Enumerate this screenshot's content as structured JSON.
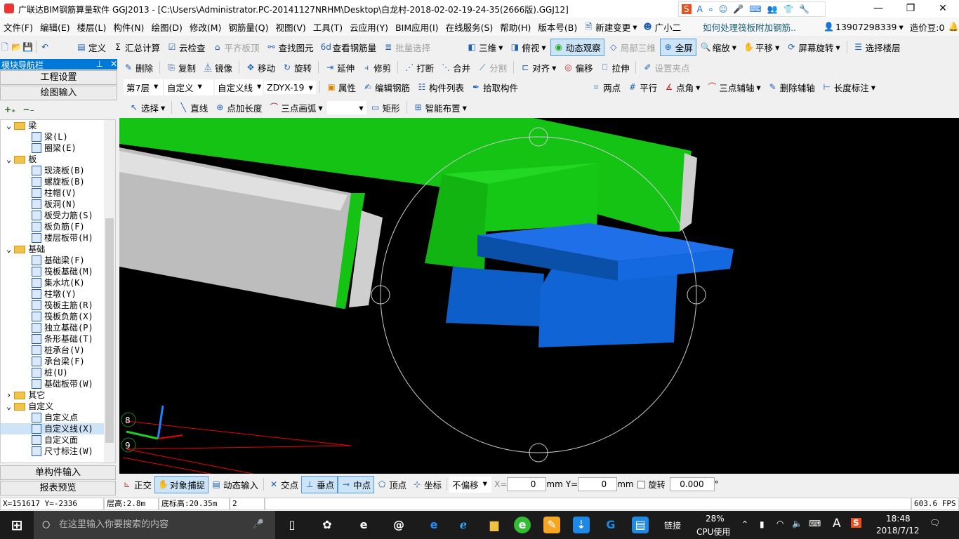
{
  "window": {
    "title": "广联达BIM钢筋算量软件 GGJ2013 - [C:\\Users\\Administrator.PC-20141127NRHM\\Desktop\\白龙村-2018-02-02-19-24-35(2666版).GGJ12]",
    "minimize": "—",
    "maximize": "❐",
    "close": "✕"
  },
  "menu": [
    "文件(F)",
    "编辑(E)",
    "楼层(L)",
    "构件(N)",
    "绘图(D)",
    "修改(M)",
    "钢筋量(Q)",
    "视图(V)",
    "工具(T)",
    "云应用(Y)",
    "BIM应用(I)",
    "在线服务(S)",
    "帮助(H)",
    "版本号(B)"
  ],
  "menu_extra": {
    "new_change": "新建变更",
    "assistant": "广小二",
    "news": "如何处理筏板附加钢筋..",
    "phone": "13907298339",
    "beans": "造价豆:0"
  },
  "toolbar1": {
    "define": "定义",
    "sum": "汇总计算",
    "cloud_check": "云检查",
    "align_top": "平齐板顶",
    "find": "查找图元",
    "view_rebar": "查看钢筋量",
    "batch_select": "批量选择",
    "view3d": "三维",
    "top_view": "俯视",
    "dynamic": "动态观察",
    "local3d": "局部三维",
    "fullscreen": "全屏",
    "zoom": "缩放",
    "pan": "平移",
    "rotate_screen": "屏幕旋转",
    "select_floor": "选择楼层"
  },
  "toolbar2": {
    "delete": "删除",
    "copy": "复制",
    "mirror": "镜像",
    "move": "移动",
    "rotate": "旋转",
    "extend": "延伸",
    "trim": "修剪",
    "break": "打断",
    "merge": "合并",
    "split": "分割",
    "align": "对齐",
    "offset": "偏移",
    "stretch": "拉伸",
    "set_grip": "设置夹点"
  },
  "toolbar3": {
    "floor": "第7层",
    "category": "自定义",
    "type": "自定义线",
    "name": "ZDYX-19",
    "props": "属性",
    "edit_rebar": "编辑钢筋",
    "list": "构件列表",
    "pick": "拾取构件",
    "two_point": "两点",
    "parallel": "平行",
    "point_angle": "点角",
    "three_point_axis": "三点辅轴",
    "del_axis": "删除辅轴",
    "length_dim": "长度标注"
  },
  "toolbar4": {
    "select": "选择",
    "line": "直线",
    "point_length": "点加长度",
    "arc": "三点画弧",
    "rect": "矩形",
    "smart": "智能布置"
  },
  "sidebar": {
    "title": "模块导航栏",
    "pin": "ꟷ",
    "close": "✕",
    "project_settings": "工程设置",
    "drawing_input": "绘图输入",
    "single_input": "单构件输入",
    "report": "报表预览",
    "tree": [
      {
        "label": "梁",
        "children": [
          "梁(L)",
          "圈梁(E)"
        ]
      },
      {
        "label": "板",
        "children": [
          "现浇板(B)",
          "螺旋板(B)",
          "柱帽(V)",
          "板洞(N)",
          "板受力筋(S)",
          "板负筋(F)",
          "楼层板带(H)"
        ]
      },
      {
        "label": "基础",
        "children": [
          "基础梁(F)",
          "筏板基础(M)",
          "集水坑(K)",
          "柱墩(Y)",
          "筏板主筋(R)",
          "筏板负筋(X)",
          "独立基础(P)",
          "条形基础(T)",
          "桩承台(V)",
          "承台梁(F)",
          "桩(U)",
          "基础板带(W)"
        ]
      },
      {
        "label": "其它",
        "children": []
      },
      {
        "label": "自定义",
        "children": [
          "自定义点",
          "自定义线(X)",
          "自定义面",
          "尺寸标注(W)"
        ]
      }
    ]
  },
  "viewport": {
    "axis_labels": [
      "8",
      "9"
    ],
    "colors": {
      "green": "#16c416",
      "blue": "#1060d0",
      "gray": "#c0c0c0"
    }
  },
  "bottombar": {
    "ortho": "正交",
    "snap": "对象捕捉",
    "dynamic_input": "动态输入",
    "intersection": "交点",
    "perpendicular": "垂点",
    "midpoint": "中点",
    "vertex": "顶点",
    "coord": "坐标",
    "offset_mode": "不偏移",
    "x_label": "X=",
    "x_value": "0",
    "y_label": "Y=",
    "y_value": "0",
    "unit": "mm",
    "rotate_label": "旋转",
    "rotate_value": "0.000",
    "degree": "°"
  },
  "status": {
    "coords": "X=151617 Y=-2336",
    "floor_height": "层高:2.8m",
    "base_height": "底标高:20.35m",
    "count": "2",
    "fps": "603.6 FPS"
  },
  "taskbar": {
    "search_placeholder": "在这里输入你要搜索的内容",
    "link": "链接",
    "cpu_pct": "28%",
    "cpu_label": "CPU使用",
    "time": "18:48",
    "date": "2018/7/12",
    "ime": "A"
  }
}
